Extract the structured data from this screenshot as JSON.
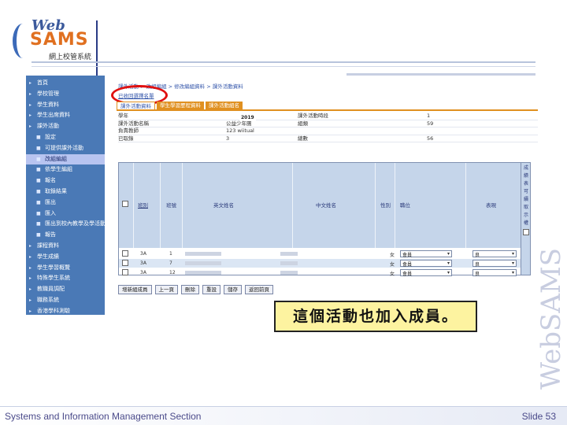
{
  "logo": {
    "web": "Web",
    "sams": "SAMS",
    "subtitle": "網上校管系統"
  },
  "sidebar": {
    "items": [
      {
        "label": "首頁",
        "level": 0
      },
      {
        "label": "學校管理",
        "level": 0
      },
      {
        "label": "學生資料",
        "level": 0
      },
      {
        "label": "學生出席資料",
        "level": 0
      },
      {
        "label": "課外活動",
        "level": 0
      },
      {
        "label": "設定",
        "level": 1
      },
      {
        "label": "可提供課外活動",
        "level": 1
      },
      {
        "label": "改組編組",
        "level": 1
      },
      {
        "label": "依學生編組",
        "level": 1
      },
      {
        "label": "報名",
        "level": 1
      },
      {
        "label": "取錄結果",
        "level": 1
      },
      {
        "label": "匯出",
        "level": 1
      },
      {
        "label": "匯入",
        "level": 1
      },
      {
        "label": "匯出到校內教學及學活動",
        "level": 1
      },
      {
        "label": "報告",
        "level": 1
      },
      {
        "label": "課程資料",
        "level": 0
      },
      {
        "label": "學生成績",
        "level": 0
      },
      {
        "label": "學生學習概覽",
        "level": 0
      },
      {
        "label": "特殊學生系統",
        "level": 0
      },
      {
        "label": "教職員調配",
        "level": 0
      },
      {
        "label": "職務系統",
        "level": 0
      },
      {
        "label": "香港學科測驗",
        "level": 0
      }
    ]
  },
  "main": {
    "breadcrumb": "課外活動 > 改組編組 > 修改編組資料 > 課外活動資料",
    "select_link": "已收回選擇名單",
    "tabs": [
      "課外活動資料",
      "學生學習歷程資料",
      "課外活動組名"
    ],
    "info": {
      "rows": [
        {
          "l1": "學年",
          "v1": "",
          "l2": "課外活動時段",
          "v2": "1"
        },
        {
          "l1": "課外活動名稱",
          "v1": "公益少年團",
          "l2": "組類",
          "v2": "59"
        },
        {
          "l1": "負責教師",
          "v1": "123 wiitual",
          "l2": "",
          "v2": ""
        },
        {
          "l1": "已取錄",
          "v1": "3",
          "l2": "總數",
          "v2": "56"
        }
      ],
      "year": "2019"
    },
    "grid": {
      "headers": [
        "選擇",
        "班別",
        "班號",
        "英文姓名",
        "中文姓名",
        "性別",
        "職位",
        "表現"
      ],
      "side_header": [
        "成",
        "績",
        "表",
        "可",
        "續",
        "取",
        "示",
        "權"
      ],
      "rows": [
        {
          "class": "3A",
          "no": "1",
          "gender": "女",
          "post": "會員",
          "perf": "良"
        },
        {
          "class": "3A",
          "no": "7",
          "gender": "女",
          "post": "會員",
          "perf": "良"
        },
        {
          "class": "3A",
          "no": "12",
          "gender": "女",
          "post": "會員",
          "perf": "良"
        }
      ]
    },
    "buttons": [
      "增新組成員",
      "上一頁",
      "刪除",
      "重設",
      "儲存",
      "返回前頁"
    ]
  },
  "callout": "這個活動也加入成員。",
  "watermark": "WebSAMS",
  "footer": {
    "left": "Systems and Information Management Section",
    "right": "Slide 53"
  }
}
